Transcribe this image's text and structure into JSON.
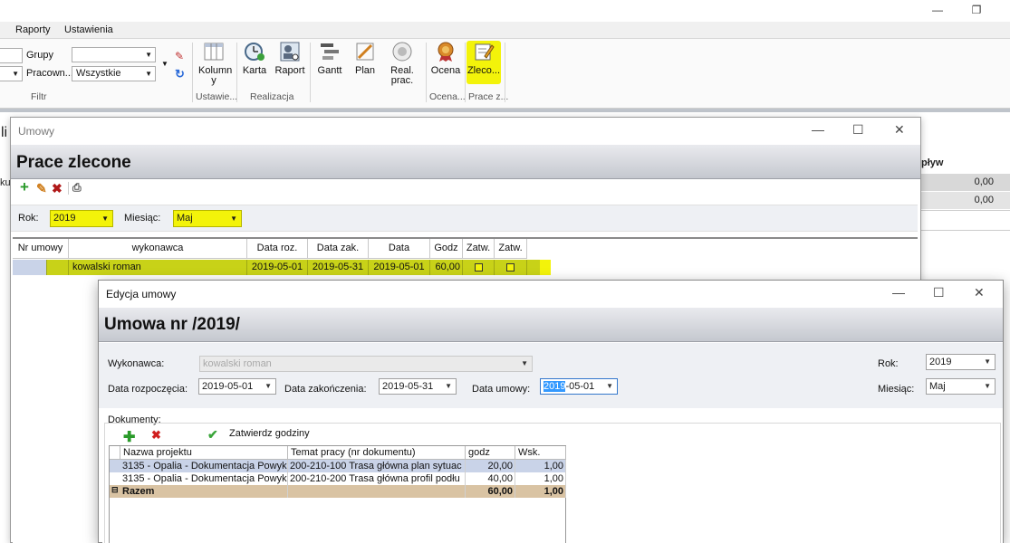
{
  "menu": {
    "raporty": "Raporty",
    "ustawienia": "Ustawienia"
  },
  "ribbon": {
    "grupy_label": "Grupy",
    "pracown_label": "Pracown...",
    "pracown_value": "Wszystkie",
    "filtr_group": "Filtr",
    "kolumny": "Kolumn y",
    "ustawie_group": "Ustawie...",
    "karta": "Karta",
    "raport": "Raport",
    "realizacja_group": "Realizacja",
    "gantt": "Gantt",
    "plan": "Plan",
    "real_prac": "Real. prac.",
    "ocena": "Ocena",
    "ocena_group": "Ocena...",
    "zleco": "Zleco...",
    "prace_group": "Prace z..."
  },
  "background": {
    "left_frag": "li",
    "left_frag2": "ku",
    "column": "pływ",
    "rows": [
      "0,00",
      "0,00"
    ]
  },
  "umowy": {
    "title": "Umowy",
    "header": "Prace zlecone",
    "rok_label": "Rok:",
    "rok_value": "2019",
    "miesiac_label": "Miesiąc:",
    "miesiac_value": "Maj",
    "columns": [
      "Nr umowy",
      "wykonawca",
      "Data roz.",
      "Data zak.",
      "Data",
      "Godz",
      "Zatw.",
      "Zatw."
    ],
    "row": {
      "nr": "",
      "wykonawca": "kowalski roman",
      "data_roz": "2019-05-01",
      "data_zak": "2019-05-31",
      "data": "2019-05-01",
      "godz": "60,00"
    }
  },
  "edycja": {
    "title": "Edycja umowy",
    "header": "Umowa nr /2019/",
    "wykonawca_label": "Wykonawca:",
    "wykonawca_value": "kowalski roman",
    "data_rozp_label": "Data rozpoczęcia:",
    "data_rozp_value": "2019-05-01",
    "data_zak_label": "Data zakończenia:",
    "data_zak_value": "2019-05-31",
    "data_umowy_label": "Data umowy:",
    "data_umowy_sel": "2019",
    "data_umowy_rest": "-05-01",
    "rok_label": "Rok:",
    "rok_value": "2019",
    "miesiac_label": "Miesiąc:",
    "miesiac_value": "Maj",
    "dokumenty_label": "Dokumenty:",
    "zatwierdz_label": "Zatwierdz godziny",
    "columns": [
      "Nazwa projektu",
      "Temat pracy (nr dokumentu)",
      "godz",
      "Wsk."
    ],
    "rows": [
      {
        "nazwa": "3135 - Opalia - Dokumentacja Powyk",
        "temat": "200-210-100 Trasa główna plan sytuac",
        "godz": "20,00",
        "wsk": "1,00"
      },
      {
        "nazwa": "3135 - Opalia - Dokumentacja Powyk",
        "temat": "200-210-200 Trasa główna profil podłu",
        "godz": "40,00",
        "wsk": "1,00"
      }
    ],
    "sum": {
      "label": "Razem",
      "godz": "60,00",
      "wsk": "1,00"
    }
  },
  "colors": {
    "highlight": "#f3f30a",
    "row_green": "#c8d218",
    "header_gray": "#c5c8cf",
    "sum_row": "#d9c3a3"
  }
}
